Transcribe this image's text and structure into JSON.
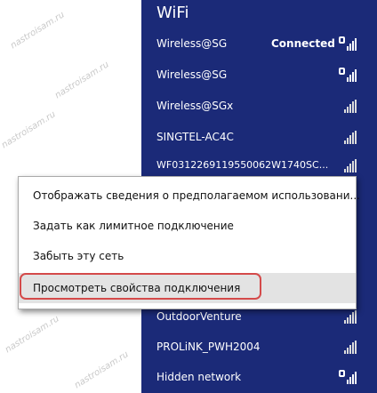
{
  "watermark": {
    "text": "nastroisam.ru"
  },
  "wifi_panel": {
    "title": "WiFi",
    "background": "#1b2a78",
    "networks": [
      {
        "name": "Wireless@SG",
        "status": "Connected",
        "signal_icon": "wifi-secured-full-icon"
      },
      {
        "name": "Wireless@SG",
        "status": "",
        "signal_icon": "wifi-secured-full-icon"
      },
      {
        "name": "Wireless@SGx",
        "status": "",
        "signal_icon": "wifi-signal-icon"
      },
      {
        "name": "SINGTEL-AC4C",
        "status": "",
        "signal_icon": "wifi-signal-icon"
      },
      {
        "name": "WF0312269119550062W1740SC...",
        "status": "",
        "signal_icon": "wifi-signal-icon"
      },
      {
        "name": "OutdoorVenture",
        "status": "",
        "signal_icon": "wifi-signal-icon"
      },
      {
        "name": "PROLiNK_PWH2004",
        "status": "",
        "signal_icon": "wifi-signal-icon"
      },
      {
        "name": "Hidden network",
        "status": "",
        "signal_icon": "wifi-secured-full-icon"
      }
    ]
  },
  "context_menu": {
    "items": [
      "Отображать сведения о предполагаемом использовани...",
      "Задать как лимитное подключение",
      "Забыть эту сеть",
      "Просмотреть свойства подключения"
    ],
    "highlight_color": "#d44a4a"
  }
}
